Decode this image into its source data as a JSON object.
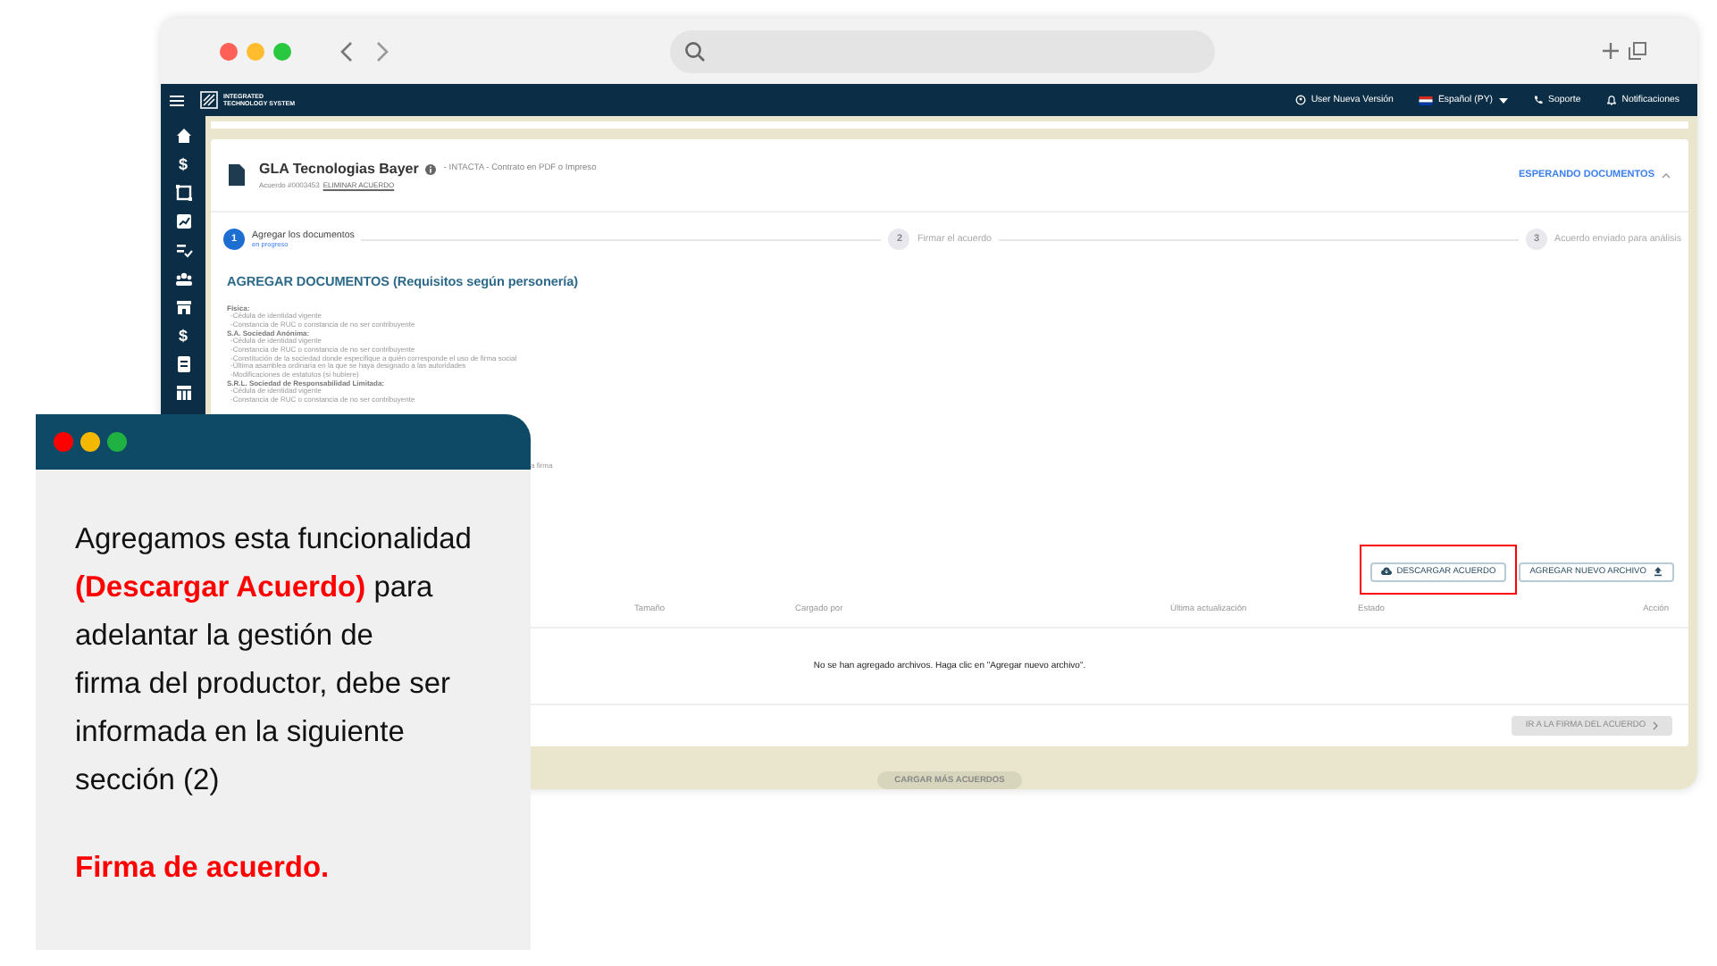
{
  "browser": {
    "dots": [
      {
        "color": "#fe5f57"
      },
      {
        "color": "#febc2e"
      },
      {
        "color": "#28c840"
      }
    ]
  },
  "navbar": {
    "logo_lines": [
      "INTEGRATED",
      "TECHNOLOGY SYSTEM"
    ],
    "items": [
      {
        "kind": "version",
        "label": "User Nueva Versión"
      },
      {
        "kind": "language",
        "label": "Español (PY)"
      },
      {
        "kind": "support",
        "label": "Soporte"
      },
      {
        "kind": "notifications",
        "label": "Notificaciones"
      }
    ]
  },
  "sidebar": {
    "items": [
      {
        "kind": "home"
      },
      {
        "kind": "text",
        "text": "$"
      },
      {
        "kind": "frame"
      },
      {
        "kind": "chart"
      },
      {
        "kind": "list"
      },
      {
        "kind": "people"
      },
      {
        "kind": "store"
      },
      {
        "kind": "text",
        "text": "$"
      },
      {
        "kind": "doc"
      },
      {
        "kind": "table"
      }
    ]
  },
  "agreement": {
    "title": "GLA Tecnologias Bayer",
    "subtitle": "- INTACTA - Contrato en PDF o Impreso",
    "number": "Acuerdo #0003453",
    "delete_link": "ELIMINAR ACUERDO",
    "status": "ESPERANDO DOCUMENTOS",
    "expanded": true
  },
  "steps": [
    {
      "number": "1",
      "label": "Agregar los documentos",
      "note": "en progreso",
      "active": true
    },
    {
      "number": "2",
      "label": "Firmar el acuerdo",
      "active": false
    },
    {
      "number": "3",
      "label": "Acuerdo enviado para análisis",
      "active": false
    }
  ],
  "section_title": "AGREGAR DOCUMENTOS (Requisitos según personería)",
  "requirements": [
    {
      "kind": "heading",
      "text": "Física:"
    },
    {
      "kind": "item",
      "text": "-Cédula de identidad vigente"
    },
    {
      "kind": "item",
      "text": "-Constancia de RUC o constancia de no ser contribuyente"
    },
    {
      "kind": "heading",
      "text": "S.A. Sociedad Anónima:"
    },
    {
      "kind": "item",
      "text": "-Cédula de identidad vigente"
    },
    {
      "kind": "item",
      "text": "-Constancia de RUC o constancia de no ser contribuyente"
    },
    {
      "kind": "item",
      "text": "-Constitución de la sociedad donde especifique a quién corresponde el uso de firma social"
    },
    {
      "kind": "item",
      "text": "-Última asamblea ordinaria en la que se haya designado a las autoridades"
    },
    {
      "kind": "item",
      "text": "-Modificaciones de estatutos (si hubiere)"
    },
    {
      "kind": "heading",
      "text": "S.R.L. Sociedad de Responsabilidad Limitada:"
    },
    {
      "kind": "item",
      "text": "-Cédula de identidad vigente"
    },
    {
      "kind": "item",
      "text": "-Constancia de RUC o constancia de no ser contribuyente"
    },
    {
      "kind": "fragment",
      "text": "a firma"
    }
  ],
  "actions": [
    {
      "kind": "download",
      "label": "DESCARGAR ACUERDO",
      "highlighted": true
    },
    {
      "kind": "upload",
      "label": "AGREGAR NUEVO ARCHIVO",
      "highlighted": false
    }
  ],
  "table": {
    "columns": [
      "Tamaño",
      "Cargado por",
      "Última actualización",
      "Estado",
      "Acción"
    ],
    "empty_message": "No se han agregado archivos. Haga clic en \"Agregar nuevo archivo\"."
  },
  "next_button": {
    "label": "IR A LA FIRMA DEL ACUERDO",
    "disabled": true
  },
  "load_more": "CARGAR MÁS ACUERDOS",
  "callout": {
    "dots": [
      {
        "color": "#ff0000"
      },
      {
        "color": "#f5b800"
      },
      {
        "color": "#1fb141"
      }
    ],
    "text": "Agregamos esta funcionalidad\n**(Descargar Acuerdo)** para\nadelantar la gestión de\nfirma del productor, debe ser\ninformada en la siguiente\nsección (2)",
    "conclusion": "Firma de acuerdo."
  }
}
